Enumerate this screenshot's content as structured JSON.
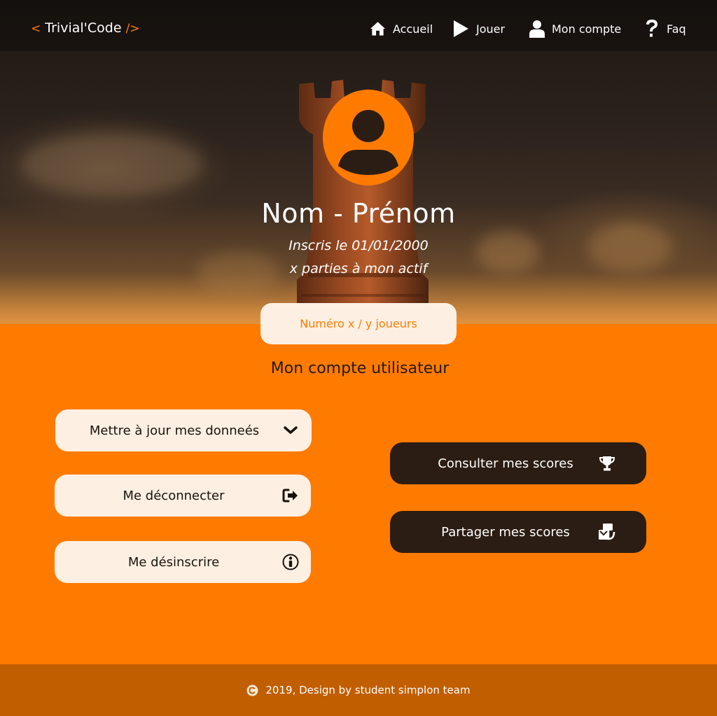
{
  "header": {
    "logo": {
      "open": "<",
      "name": "Trivial'Code",
      "close": "/>"
    },
    "nav": [
      {
        "label": "Accueil",
        "icon": "home-icon"
      },
      {
        "label": "Jouer",
        "icon": "play-icon"
      },
      {
        "label": "Mon compte",
        "icon": "user-icon"
      },
      {
        "label": "Faq",
        "icon": "question-icon"
      }
    ]
  },
  "profile": {
    "avatar_icon": "user-circle-icon",
    "name": "Nom - Prénom",
    "registered": "Inscris le 01/01/2000",
    "games": "x parties à mon actif",
    "rank": "Numéro x / y joueurs"
  },
  "account": {
    "title": "Mon compte utilisateur",
    "actions_left": [
      {
        "label": "Mettre à jour mes donneés",
        "icon": "chevron-down-icon"
      },
      {
        "label": "Me déconnecter",
        "icon": "sign-out-icon"
      },
      {
        "label": "Me désinscrire",
        "icon": "info-circle-icon"
      }
    ],
    "actions_right": [
      {
        "label": "Consulter mes scores",
        "icon": "trophy-icon"
      },
      {
        "label": "Partager mes scores",
        "icon": "share-icon"
      }
    ]
  },
  "footer": {
    "text": "2019, Design by student simplon team",
    "icon": "copyright-icon"
  },
  "colors": {
    "accent": "#ff7b00",
    "dark": "#2b1d13",
    "light": "#fdf0e3",
    "footer": "#c15e00"
  }
}
